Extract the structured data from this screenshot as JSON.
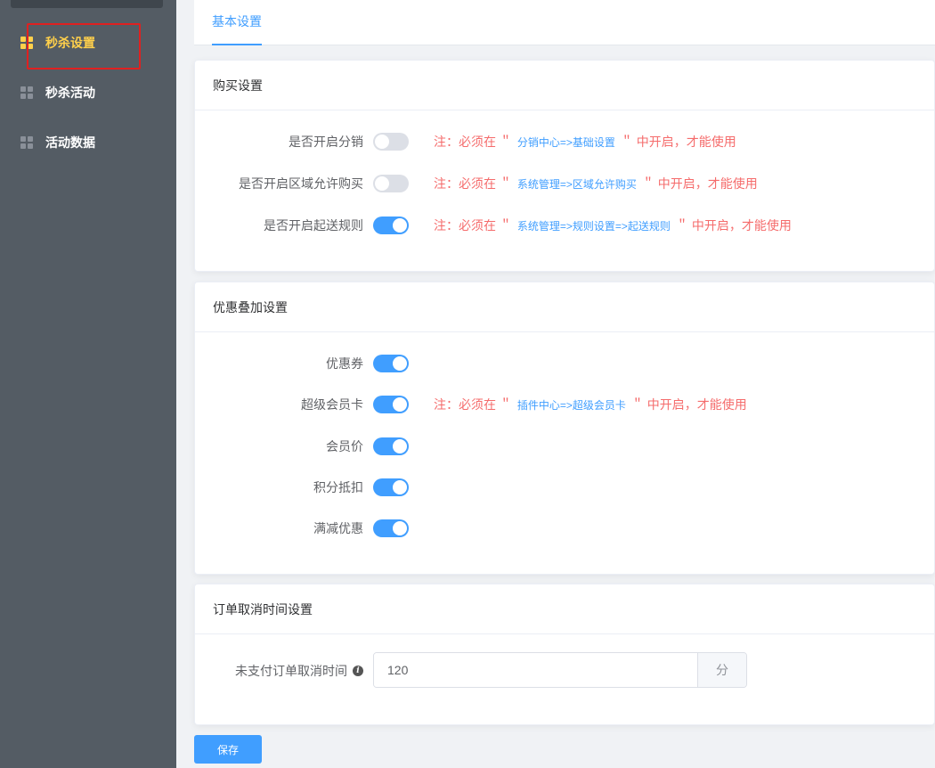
{
  "sidebar": {
    "items": [
      {
        "label": "秒杀设置",
        "icon": "grid-icon",
        "active": true
      },
      {
        "label": "秒杀活动",
        "icon": "grid-icon",
        "active": false
      },
      {
        "label": "活动数据",
        "icon": "grid-icon",
        "active": false
      }
    ]
  },
  "tabs": [
    {
      "label": "基本设置",
      "active": true
    }
  ],
  "purchase": {
    "title": "购买设置",
    "rows": [
      {
        "label": "是否开启分销",
        "enabled": false,
        "note_prefix": "注：必须在 ＂",
        "note_link": "分销中心=>基础设置",
        "note_suffix": "＂ 中开启，才能使用"
      },
      {
        "label": "是否开启区域允许购买",
        "enabled": false,
        "note_prefix": "注：必须在 ＂",
        "note_link": "系统管理=>区域允许购买",
        "note_suffix": "＂ 中开启，才能使用"
      },
      {
        "label": "是否开启起送规则",
        "enabled": true,
        "note_prefix": "注：必须在 ＂",
        "note_link": "系统管理=>规则设置=>起送规则",
        "note_suffix": "＂ 中开启，才能使用"
      }
    ]
  },
  "discount": {
    "title": "优惠叠加设置",
    "rows": [
      {
        "label": "优惠券",
        "enabled": true
      },
      {
        "label": "超级会员卡",
        "enabled": true,
        "note_prefix": "注：必须在 ＂",
        "note_link": "插件中心=>超级会员卡",
        "note_suffix": "＂ 中开启，才能使用"
      },
      {
        "label": "会员价",
        "enabled": true
      },
      {
        "label": "积分抵扣",
        "enabled": true
      },
      {
        "label": "满减优惠",
        "enabled": true
      }
    ]
  },
  "order_cancel": {
    "title": "订单取消时间设置",
    "label": "未支付订单取消时间",
    "value": "120",
    "unit": "分"
  },
  "save_label": "保存",
  "colors": {
    "accent": "#409eff",
    "active_nav": "#ffd04b",
    "note": "#f56c6c",
    "sidebar_bg": "#545c64"
  }
}
